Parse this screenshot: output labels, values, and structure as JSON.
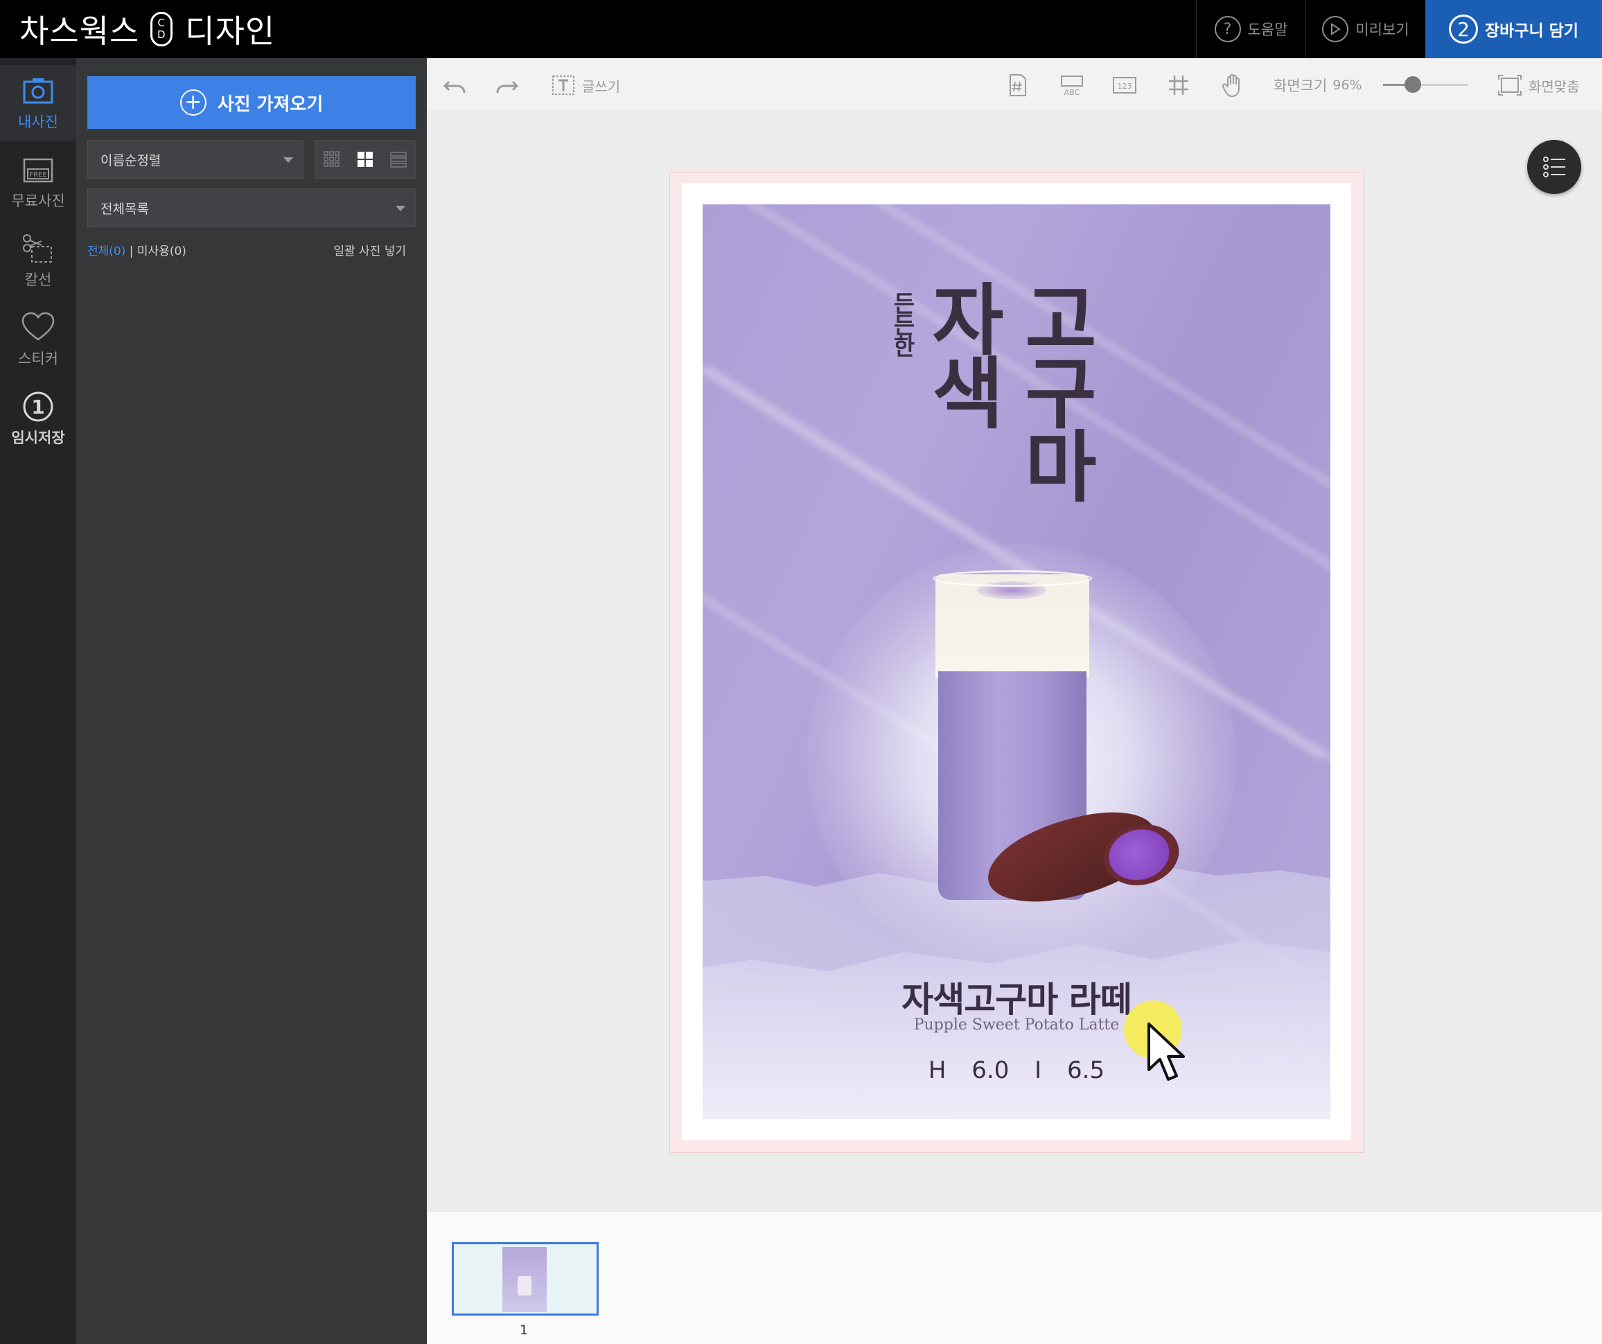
{
  "app": {
    "brand_left": "차스웍스",
    "brand_cd_top": "C",
    "brand_cd_bottom": "D",
    "brand_right": "디자인"
  },
  "topbar": {
    "help_label": "도움말",
    "help_icon": "?",
    "preview_label": "미리보기",
    "cart_step": "2",
    "cart_label": "장바구니 담기",
    "cart_color": "#1b5fb5"
  },
  "rail": {
    "items": [
      {
        "label": "내사진",
        "icon": "camera-icon"
      },
      {
        "label": "무료사진",
        "icon": "free-photo-icon"
      },
      {
        "label": "칼선",
        "icon": "scissors-icon"
      },
      {
        "label": "스티커",
        "icon": "heart-icon"
      },
      {
        "label": "임시저장",
        "icon": "step-one-icon",
        "number": "1"
      }
    ]
  },
  "panel": {
    "import_label": "사진 가져오기",
    "sort_value": "이름순정렬",
    "folder_value": "전체목록",
    "count_all": "전체(0)",
    "count_sep": "|",
    "count_unused": "미사용(0)",
    "bulk_insert": "일괄 사진 넣기",
    "accent_color": "#3d80e6"
  },
  "toolbar": {
    "text_tool_label": "글쓰기",
    "abc_label": "ABC",
    "num_label": "123",
    "zoom_label": "화면크기",
    "zoom_value": "96%",
    "zoom_level": 0.35,
    "fit_label": "화면맞춤"
  },
  "poster": {
    "vertical_small": "든든한",
    "vertical_col1": "자색",
    "vertical_col2": "고구마",
    "title": "자색고구마 라떼",
    "subtitle": "Pupple Sweet Potato Latte",
    "price_hot": "H 6.0",
    "price_ice": "I 6.5",
    "bg_color": "#b1a4d9"
  },
  "thumbnails": {
    "pages": [
      {
        "number": "1"
      }
    ]
  }
}
